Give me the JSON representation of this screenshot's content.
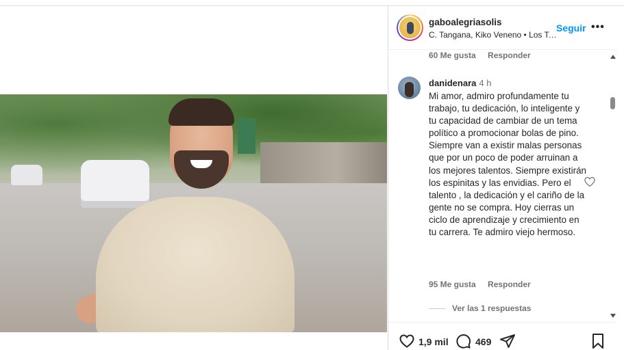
{
  "post": {
    "username": "gaboalegriasolis",
    "audio": "C. Tangana, Kiko Veneno • Los Tontos (feat. Kiko Veneno)",
    "follow_label": "Seguir",
    "more_label": "•••"
  },
  "previous_comment": {
    "likes": "60 Me gusta",
    "reply_label": "Responder"
  },
  "comment": {
    "username": "danidenara",
    "time": "4 h",
    "text": "Mi amor, admiro profundamente tu trabajo, tu dedicación, lo inteligente y tu capacidad de cambiar de un tema político a promocionar bolas de pino. Siempre van a existir malas personas que por un poco de poder arruinan a los mejores talentos. Siempre existirán los espinitas y las envidias. Pero el talento , la dedicación y el cariño de la gente no se compra. Hoy cierras un ciclo de aprendizaje y crecimiento en tu carrera. Te admiro viejo hermoso.",
    "likes": "95 Me gusta",
    "reply_label": "Responder",
    "view_replies": "Ver las 1 respuestas"
  },
  "actions": {
    "like_count": "1,9 mil",
    "comment_count": "469"
  }
}
